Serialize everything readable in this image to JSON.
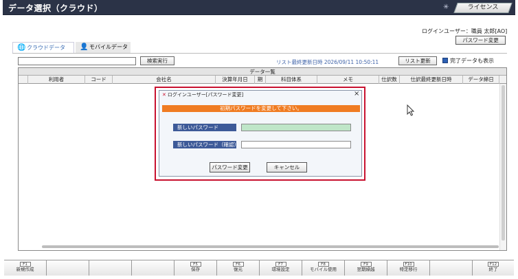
{
  "titlebar": {
    "title": "データ選択（クラウド）",
    "license_button": "ライセンス"
  },
  "header": {
    "login_user": "ログインユーザー：職員 太郎[AO]",
    "password_change_button": "パスワード変更"
  },
  "tabs": [
    {
      "label": "クラウドデータ",
      "icon": "globe-icon",
      "active": true
    },
    {
      "label": "モバイルデータ",
      "icon": "person-icon",
      "active": false
    }
  ],
  "toolbar": {
    "search_value": "",
    "search_button": "検索実行",
    "list_updated": "リスト最終更新日時 2026/09/11 10:50:11",
    "list_refresh_button": "リスト更新",
    "show_completed_label": "完了データも表示",
    "show_completed_checked": true
  },
  "table": {
    "caption": "データ一覧",
    "columns": [
      "",
      "利用者",
      "コード",
      "会社名",
      "決算年月日",
      "期",
      "科目体系",
      "メモ",
      "仕訳数",
      "仕訳最終更新日時",
      "データ締日"
    ],
    "rows": []
  },
  "modal": {
    "title": "ログインユーザー[パスワード変更]",
    "banner": "初期パスワードを変更して下さい。",
    "new_password_label": "新しいパスワード",
    "new_password_value": "",
    "confirm_password_label": "新しいパスワード（確認）",
    "confirm_password_value": "",
    "change_button": "パスワード変更",
    "cancel_button": "キャンセル"
  },
  "function_keys": [
    {
      "key": "F1",
      "label": "新規作成"
    },
    {
      "key": "",
      "label": ""
    },
    {
      "key": "",
      "label": ""
    },
    {
      "key": "",
      "label": ""
    },
    {
      "key": "F5",
      "label": "保存"
    },
    {
      "key": "F6",
      "label": "復元"
    },
    {
      "key": "F7",
      "label": "環境設定"
    },
    {
      "key": "F8",
      "label": "モバイル使用"
    },
    {
      "key": "F9",
      "label": "翌期繰越"
    },
    {
      "key": "F10",
      "label": "特定移行"
    },
    {
      "key": "",
      "label": ""
    },
    {
      "key": "F12",
      "label": "終了"
    }
  ],
  "colors": {
    "titlebar": "#2b3347",
    "accent_blue": "#3d5a98",
    "warning_orange": "#f07c22",
    "highlight_red": "#c8102e",
    "new_pw_field": "#bfe6c8"
  }
}
